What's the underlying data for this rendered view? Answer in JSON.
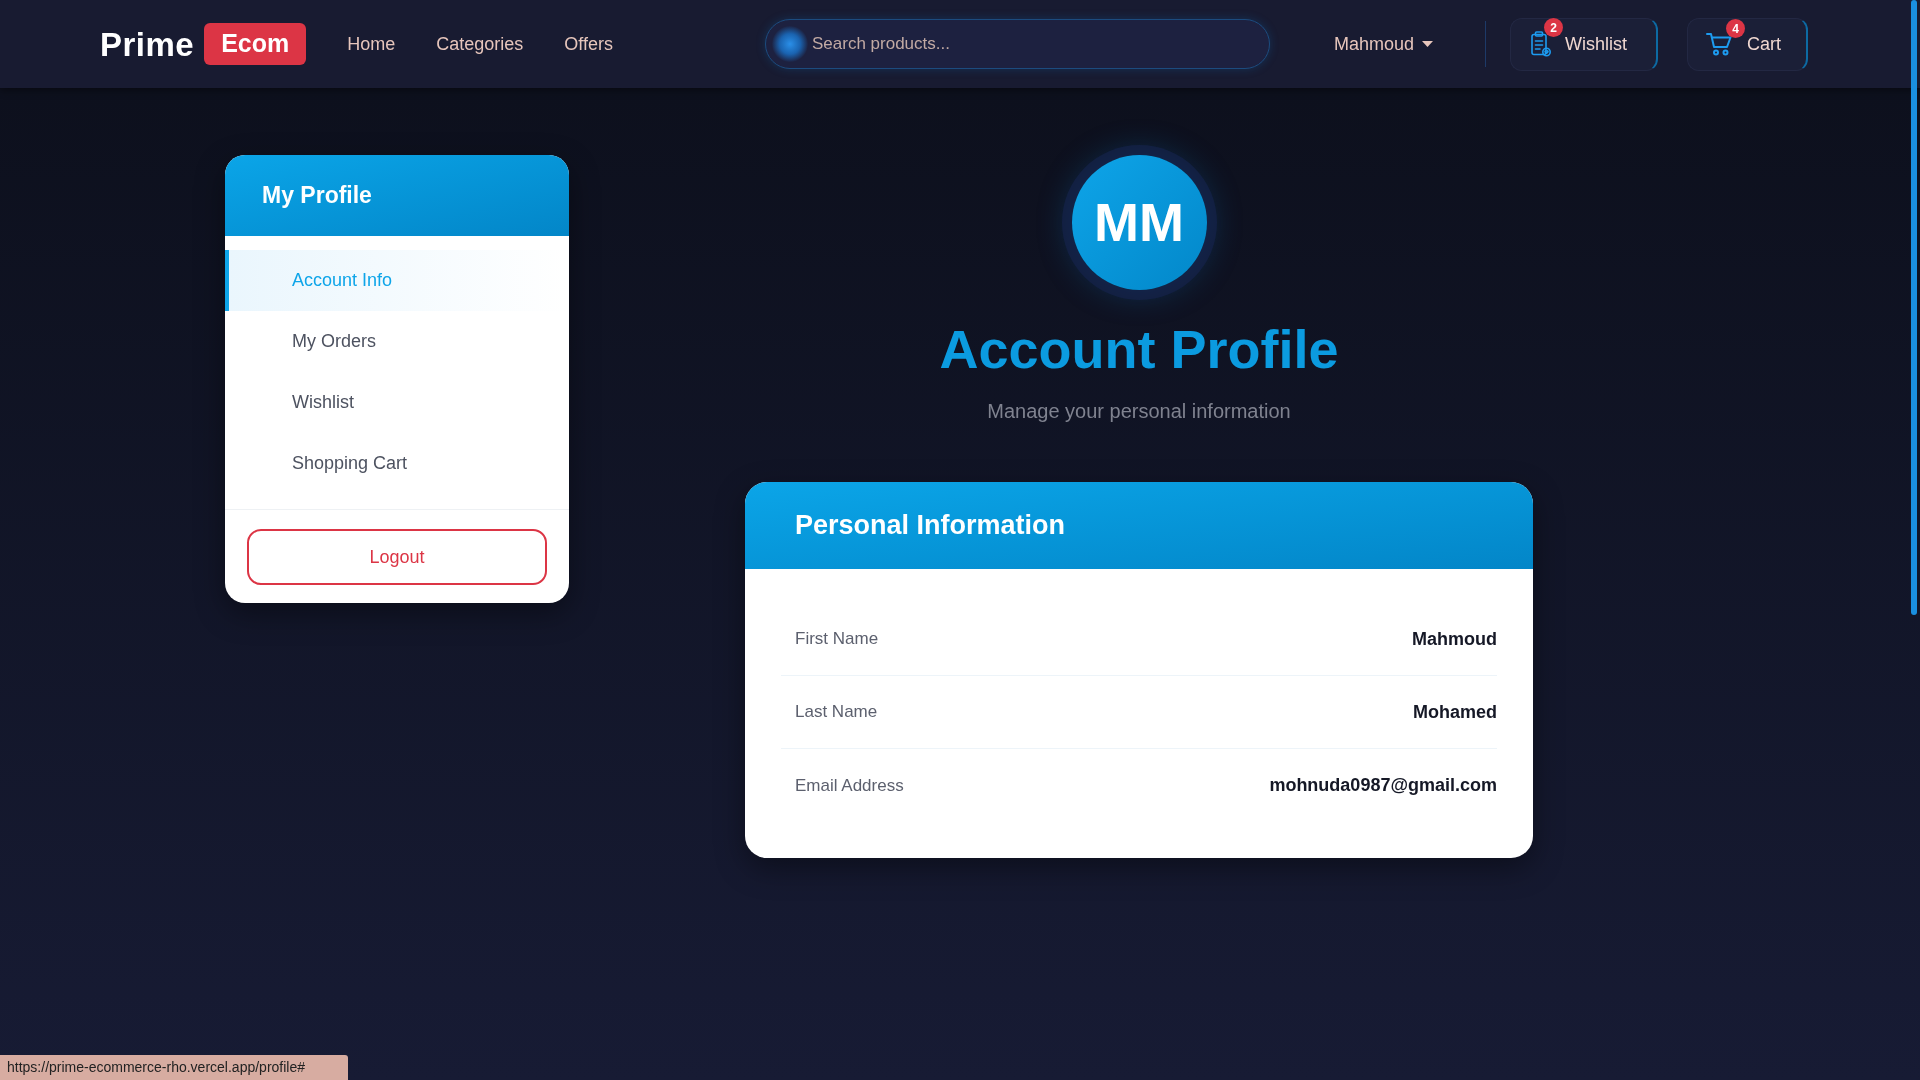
{
  "navbar": {
    "logo": {
      "text": "Prime",
      "badge": "Ecom"
    },
    "links": [
      {
        "label": "Home"
      },
      {
        "label": "Categories"
      },
      {
        "label": "Offers"
      }
    ],
    "search": {
      "placeholder": "Search products..."
    },
    "user_menu": {
      "label": "Mahmoud"
    },
    "buttons": [
      {
        "kind": "wishlist",
        "label": "Wishlist",
        "count": "2"
      },
      {
        "kind": "cart",
        "label": "Cart",
        "count": "4"
      }
    ]
  },
  "sidebar": {
    "title": "My Profile",
    "items": [
      {
        "label": "Account Info",
        "selected": true
      },
      {
        "label": "My Orders",
        "selected": false
      },
      {
        "label": "Wishlist",
        "selected": false
      },
      {
        "label": "Shopping Cart",
        "selected": false
      }
    ],
    "logout": "Logout"
  },
  "profile": {
    "initials": "MM",
    "title": "Account Profile",
    "subtitle": "Manage your personal information"
  },
  "info_card": {
    "title": "Personal Information",
    "fields": [
      {
        "label": "First Name",
        "value": "Mahmoud"
      },
      {
        "label": "Last Name",
        "value": "Mohamed"
      },
      {
        "label": "Email Address",
        "value": "mohnuda0987@gmail.com"
      }
    ]
  },
  "status_bar": {
    "url": "https://prime-ecommerce-rho.vercel.app/profile#"
  }
}
